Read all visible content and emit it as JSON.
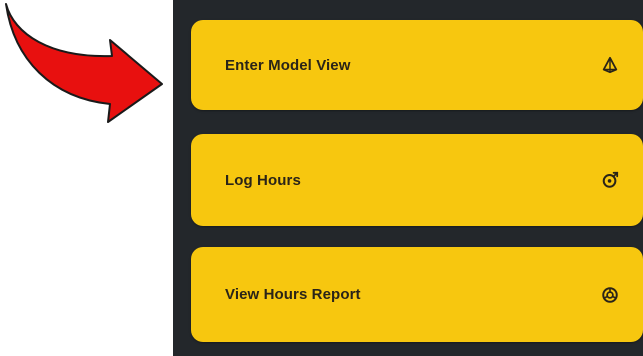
{
  "colors": {
    "button_background": "#f7c70f",
    "panel_background": "#23272b",
    "label_text": "#2a2418",
    "arrow_fill": "#e8100f",
    "arrow_stroke": "#1a1a1a"
  },
  "menu": {
    "items": [
      {
        "label": "Enter Model View",
        "icon": "cube-outline-icon"
      },
      {
        "label": "Log Hours",
        "icon": "timer-refresh-icon"
      },
      {
        "label": "View Hours Report",
        "icon": "pie-chart-icon"
      }
    ]
  },
  "annotation": {
    "icon": "curved-arrow-pointer"
  }
}
